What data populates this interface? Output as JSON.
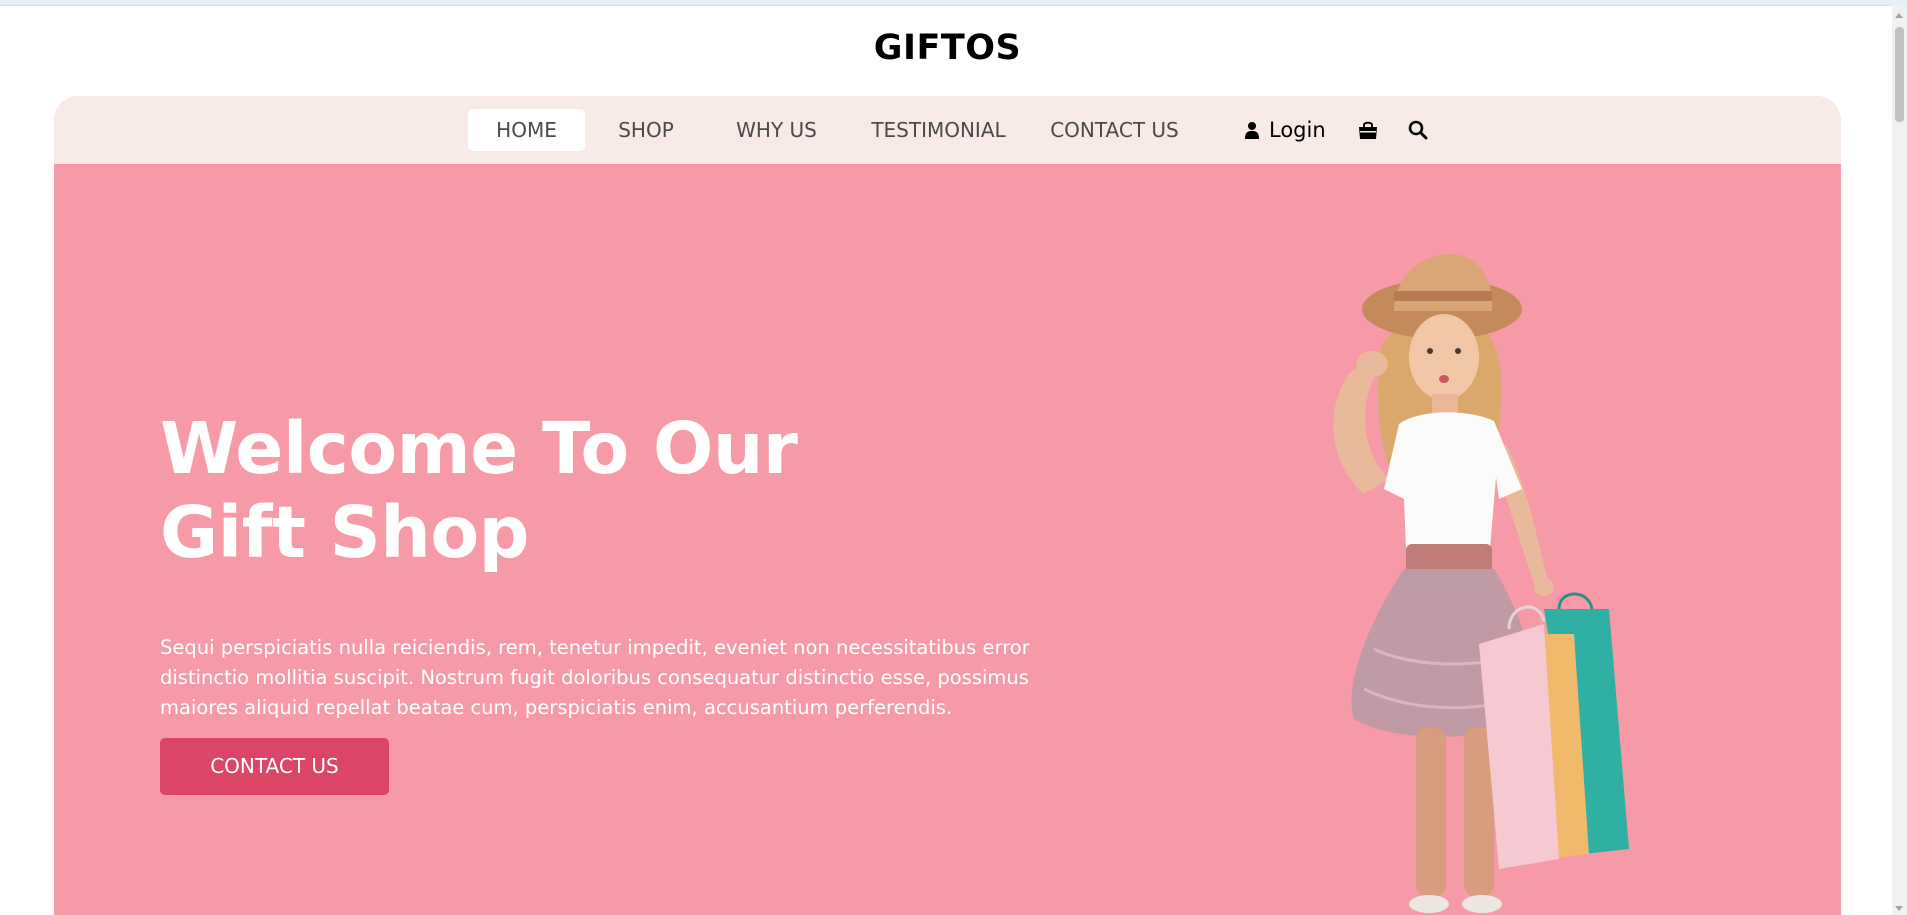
{
  "brand": {
    "name": "GIFTOS"
  },
  "nav": {
    "items": [
      {
        "label": "HOME",
        "active": true
      },
      {
        "label": "SHOP"
      },
      {
        "label": "WHY US"
      },
      {
        "label": "TESTIMONIAL"
      },
      {
        "label": "CONTACT US"
      }
    ],
    "login_label": "Login",
    "icons": [
      "user-icon",
      "shopping-bag-icon",
      "search-icon"
    ]
  },
  "hero": {
    "title_line1": "Welcome To Our",
    "title_line2": "Gift Shop",
    "text": "Sequi perspiciatis nulla reiciendis, rem, tenetur impedit, eveniet non necessitatibus error distinctio mollitia suscipit. Nostrum fugit doloribus consequatur distinctio esse, possimus maiores aliquid repellat beatae cum, perspiciatis enim, accusantium perferendis.",
    "button_label": "CONTACT US",
    "image": "girl-with-shopping-bags"
  },
  "colors": {
    "nav_bg": "#f8eae6",
    "hero_bg": "#f79aa8",
    "button_bg": "#db4566",
    "text_light": "#ffffff",
    "text_dark": "#000000"
  }
}
